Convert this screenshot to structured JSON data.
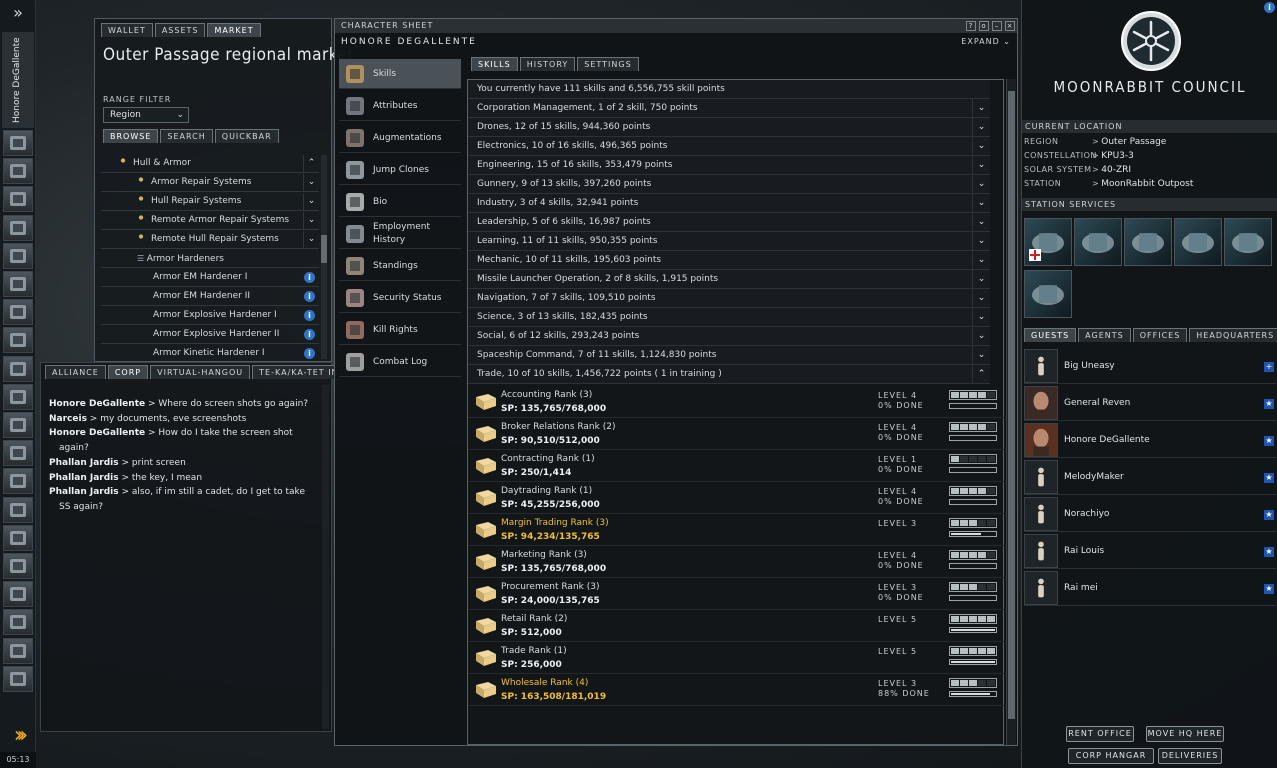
{
  "neocom": {
    "pilot_name": "Honore DeGallente",
    "clock": "05:13"
  },
  "market": {
    "tabs": [
      "WALLET",
      "ASSETS",
      "MARKET"
    ],
    "title": "Outer Passage regional market",
    "range_label": "RANGE FILTER",
    "range_value": "Region",
    "browse_tabs": [
      "BROWSE",
      "SEARCH",
      "QUICKBAR"
    ],
    "rows": [
      {
        "label": "Hull & Armor",
        "kind": "group"
      },
      {
        "label": "Armor Repair Systems",
        "kind": "group"
      },
      {
        "label": "Hull Repair Systems",
        "kind": "group"
      },
      {
        "label": "Remote Armor Repair Systems",
        "kind": "group"
      },
      {
        "label": "Remote Hull Repair Systems",
        "kind": "group"
      },
      {
        "label": "Armor Hardeners",
        "kind": "list"
      },
      {
        "label": "Armor EM Hardener I",
        "kind": "item"
      },
      {
        "label": "Armor EM Hardener II",
        "kind": "item"
      },
      {
        "label": "Armor Explosive Hardener I",
        "kind": "item"
      },
      {
        "label": "Armor Explosive Hardener II",
        "kind": "item"
      },
      {
        "label": "Armor Kinetic Hardener I",
        "kind": "item"
      }
    ]
  },
  "chat": {
    "tabs": [
      "ALLIANCE",
      "CORP",
      "VIRTUAL-HANGOU",
      "TE-KA/KA-TET INTE"
    ],
    "messages": [
      {
        "who": "Honore DeGallente",
        "text": "Where do screen shots go again?",
        "bold": true
      },
      {
        "who": "Narceis",
        "text": "my documents, eve screenshots",
        "bold": true
      },
      {
        "who": "Honore DeGallente",
        "text": "How do I take the screen shot",
        "cont": "again?",
        "bold": true
      },
      {
        "who": "Phallan Jardis",
        "text": "print screen",
        "bold": true
      },
      {
        "who": "Phallan Jardis",
        "text": "the key, I mean",
        "bold": true
      },
      {
        "who": "Phallan Jardis",
        "text": "also, if im still a cadet, do I get to take",
        "cont": "SS again?",
        "bold": true
      }
    ]
  },
  "character_sheet": {
    "header": "CHARACTER SHEET",
    "pilot": "HONORE DEGALLENTE",
    "expand": "EXPAND",
    "nav": [
      "Skills",
      "Attributes",
      "Augmentations",
      "Jump Clones",
      "Bio",
      "Employment History",
      "Standings",
      "Security Status",
      "Kill Rights",
      "Combat Log"
    ],
    "tabs": [
      "SKILLS",
      "HISTORY",
      "SETTINGS"
    ],
    "summary": "You currently have 111 skills and 6,556,755 skill points",
    "groups": [
      "Corporation Management, 1 of 2 skill, 750 points",
      "Drones, 12 of 15 skills, 944,360 points",
      "Electronics, 10 of 16 skills, 496,365 points",
      "Engineering, 15 of 16 skills, 353,479 points",
      "Gunnery, 9 of 13 skills, 397,260 points",
      "Industry, 3 of 4 skills, 32,941 points",
      "Leadership, 5 of 6 skills, 16,987 points",
      "Learning, 11 of 11 skills, 950,355 points",
      "Mechanic, 10 of 11 skills, 195,603 points",
      "Missile Launcher Operation, 2 of 8 skills, 1,915 points",
      "Navigation, 7 of 7 skills, 109,510 points",
      "Science, 3 of 13 skills, 182,435 points",
      "Social, 6 of 12 skills, 293,243 points",
      "Spaceship Command, 7 of 11 skills, 1,124,830 points",
      "Trade, 10 of 10 skills, 1,456,722 points ( 1 in training )"
    ],
    "trade_skills": [
      {
        "name": "Accounting Rank (3)",
        "sp": "SP: 135,765/768,000",
        "level": "LEVEL 4",
        "done": "0% DONE",
        "lvl": 4,
        "progress": 0,
        "highlight": false
      },
      {
        "name": "Broker Relations Rank (2)",
        "sp": "SP: 90,510/512,000",
        "level": "LEVEL 4",
        "done": "0% DONE",
        "lvl": 4,
        "progress": 0,
        "highlight": false
      },
      {
        "name": "Contracting Rank (1)",
        "sp": "SP: 250/1,414",
        "level": "LEVEL 1",
        "done": "0% DONE",
        "lvl": 1,
        "progress": 0,
        "highlight": false
      },
      {
        "name": "Daytrading Rank (1)",
        "sp": "SP: 45,255/256,000",
        "level": "LEVEL 4",
        "done": "0% DONE",
        "lvl": 4,
        "progress": 0,
        "highlight": false
      },
      {
        "name": "Margin Trading Rank (3)",
        "sp": "SP: 94,234/135,765",
        "level": "LEVEL 3",
        "done": "",
        "lvl": 3,
        "progress": 0.69,
        "highlight": true
      },
      {
        "name": "Marketing Rank (3)",
        "sp": "SP: 135,765/768,000",
        "level": "LEVEL 4",
        "done": "0% DONE",
        "lvl": 4,
        "progress": 0,
        "highlight": false
      },
      {
        "name": "Procurement Rank (3)",
        "sp": "SP: 24,000/135,765",
        "level": "LEVEL 3",
        "done": "0% DONE",
        "lvl": 3,
        "progress": 0,
        "highlight": false
      },
      {
        "name": "Retail Rank (2)",
        "sp": "SP: 512,000",
        "level": "LEVEL 5",
        "done": "",
        "lvl": 5,
        "progress": 1,
        "highlight": false
      },
      {
        "name": "Trade Rank (1)",
        "sp": "SP: 256,000",
        "level": "LEVEL 5",
        "done": "",
        "lvl": 5,
        "progress": 1,
        "highlight": false
      },
      {
        "name": "Wholesale Rank (4)",
        "sp": "SP: 163,508/181,019",
        "level": "LEVEL 3",
        "done": "88% DONE",
        "lvl": 3,
        "progress": 0.88,
        "highlight": true
      }
    ]
  },
  "station": {
    "corp_name": "MOONRABBIT COUNCIL",
    "current_location": "CURRENT LOCATION",
    "location": [
      {
        "k": "REGION",
        "v": "Outer Passage"
      },
      {
        "k": "CONSTELLATION",
        "v": "KPU3-3"
      },
      {
        "k": "SOLAR SYSTEM",
        "v": "40-ZRI"
      },
      {
        "k": "STATION",
        "v": "MoonRabbit Outpost"
      }
    ],
    "services_label": "STATION SERVICES",
    "guest_tabs": [
      "GUESTS",
      "AGENTS",
      "OFFICES",
      "HEADQUARTERS"
    ],
    "guests": [
      "Big Uneasy",
      "General Reven",
      "Honore DeGallente",
      "MelodyMaker",
      "Norachiyo",
      "Rai Louis",
      "Rai mei"
    ],
    "buttons": [
      "RENT OFFICE",
      "MOVE HQ HERE",
      "CORP HANGAR",
      "DELIVERIES"
    ]
  },
  "colors": {
    "highlight": "#f0c030",
    "info_blue": "#2f74c8"
  }
}
